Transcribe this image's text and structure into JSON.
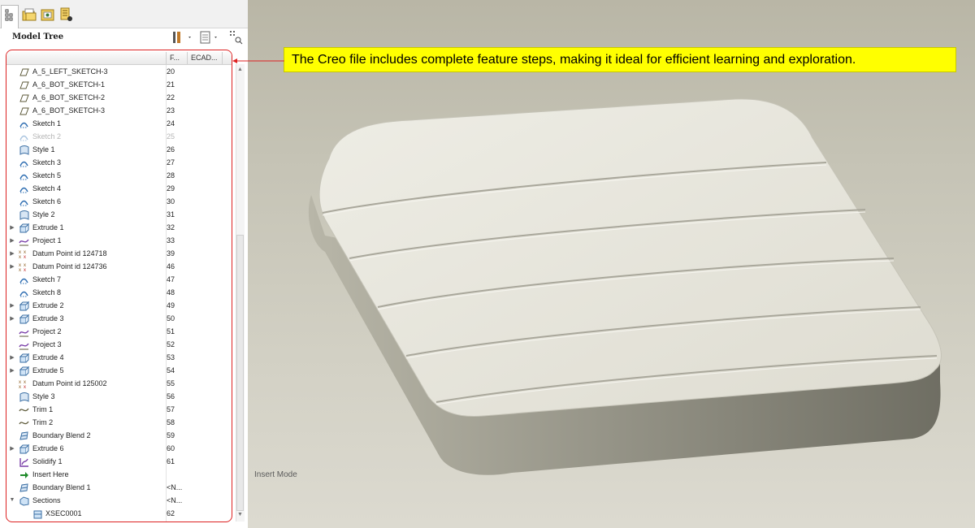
{
  "panel": {
    "title": "Model Tree",
    "columns": {
      "feature": "F...",
      "ecad": "ECAD..."
    }
  },
  "tree": {
    "rows": [
      {
        "label": "A_5_LEFT_SKETCH-3",
        "num": "20",
        "icon": "datum-plane-icon",
        "expander": ""
      },
      {
        "label": "A_6_BOT_SKETCH-1",
        "num": "21",
        "icon": "datum-plane-icon",
        "expander": ""
      },
      {
        "label": "A_6_BOT_SKETCH-2",
        "num": "22",
        "icon": "datum-plane-icon",
        "expander": ""
      },
      {
        "label": "A_6_BOT_SKETCH-3",
        "num": "23",
        "icon": "datum-plane-icon",
        "expander": ""
      },
      {
        "label": "Sketch 1",
        "num": "24",
        "icon": "sketch-icon",
        "expander": ""
      },
      {
        "label": "Sketch 2",
        "num": "25",
        "icon": "sketch-icon",
        "expander": "",
        "dim": true
      },
      {
        "label": "Style 1",
        "num": "26",
        "icon": "style-icon",
        "expander": ""
      },
      {
        "label": "Sketch 3",
        "num": "27",
        "icon": "sketch-icon",
        "expander": ""
      },
      {
        "label": "Sketch 5",
        "num": "28",
        "icon": "sketch-icon",
        "expander": ""
      },
      {
        "label": "Sketch 4",
        "num": "29",
        "icon": "sketch-icon",
        "expander": ""
      },
      {
        "label": "Sketch 6",
        "num": "30",
        "icon": "sketch-icon",
        "expander": ""
      },
      {
        "label": "Style 2",
        "num": "31",
        "icon": "style-icon",
        "expander": ""
      },
      {
        "label": "Extrude 1",
        "num": "32",
        "icon": "extrude-icon",
        "expander": "▶"
      },
      {
        "label": "Project 1",
        "num": "33",
        "icon": "project-icon",
        "expander": "▶"
      },
      {
        "label": "Datum Point id 124718",
        "num": "39",
        "icon": "datum-point-icon",
        "expander": "▶"
      },
      {
        "label": "Datum Point id 124736",
        "num": "46",
        "icon": "datum-point-icon",
        "expander": "▶"
      },
      {
        "label": "Sketch 7",
        "num": "47",
        "icon": "sketch-icon",
        "expander": ""
      },
      {
        "label": "Sketch 8",
        "num": "48",
        "icon": "sketch-icon",
        "expander": ""
      },
      {
        "label": "Extrude 2",
        "num": "49",
        "icon": "extrude-icon",
        "expander": "▶"
      },
      {
        "label": "Extrude 3",
        "num": "50",
        "icon": "extrude-icon",
        "expander": "▶"
      },
      {
        "label": "Project 2",
        "num": "51",
        "icon": "project-icon",
        "expander": ""
      },
      {
        "label": "Project 3",
        "num": "52",
        "icon": "project-icon",
        "expander": ""
      },
      {
        "label": "Extrude 4",
        "num": "53",
        "icon": "extrude-icon",
        "expander": "▶"
      },
      {
        "label": "Extrude 5",
        "num": "54",
        "icon": "extrude-icon",
        "expander": "▶"
      },
      {
        "label": "Datum Point id 125002",
        "num": "55",
        "icon": "datum-point-icon",
        "expander": ""
      },
      {
        "label": "Style 3",
        "num": "56",
        "icon": "style-icon",
        "expander": ""
      },
      {
        "label": "Trim 1",
        "num": "57",
        "icon": "trim-icon",
        "expander": ""
      },
      {
        "label": "Trim 2",
        "num": "58",
        "icon": "trim-icon",
        "expander": ""
      },
      {
        "label": "Boundary Blend 2",
        "num": "59",
        "icon": "boundary-blend-icon",
        "expander": ""
      },
      {
        "label": "Extrude 6",
        "num": "60",
        "icon": "extrude-icon",
        "expander": "▶"
      },
      {
        "label": "Solidify 1",
        "num": "61",
        "icon": "solidify-icon",
        "expander": ""
      },
      {
        "label": "Insert Here",
        "num": "",
        "icon": "insert-here-arrow-icon",
        "expander": ""
      },
      {
        "label": "Boundary Blend 1",
        "num": "<N...",
        "icon": "boundary-blend-icon",
        "expander": ""
      },
      {
        "label": "Sections",
        "num": "<N...",
        "icon": "sections-icon",
        "expander": "▼"
      },
      {
        "label": "XSEC0001",
        "num": "62",
        "icon": "xsec-icon",
        "expander": "",
        "child": true
      }
    ]
  },
  "viewport": {
    "status": "Insert Mode"
  },
  "callout": {
    "text": "The Creo file includes complete feature steps, making it ideal for efficient learning and exploration."
  },
  "colors": {
    "callout_bg": "#ffff00",
    "highlight_border": "#dd2222",
    "model_surface": "#d8d6ca"
  }
}
